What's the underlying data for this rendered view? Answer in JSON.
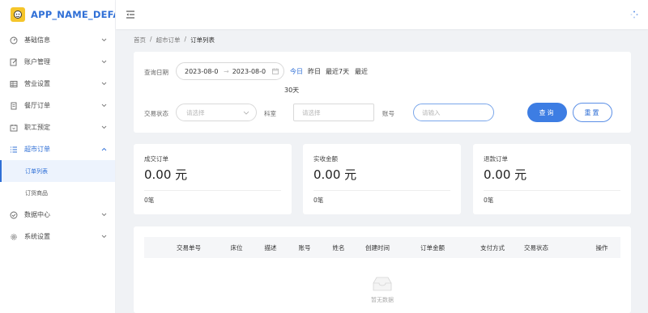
{
  "app": {
    "name": "APP_NAME_DEFAULT"
  },
  "sidebar": {
    "items": [
      {
        "label": "基础信息",
        "icon": "dashboard-icon"
      },
      {
        "label": "账户管理",
        "icon": "edit-icon"
      },
      {
        "label": "营业设置",
        "icon": "table-icon"
      },
      {
        "label": "餐厅订单",
        "icon": "document-icon"
      },
      {
        "label": "职工预定",
        "icon": "calendar-icon"
      },
      {
        "label": "超市订单",
        "icon": "list-icon",
        "open": true,
        "children": [
          {
            "label": "订单列表",
            "active": true
          },
          {
            "label": "订货商品"
          }
        ]
      },
      {
        "label": "数据中心",
        "icon": "check-circle-icon"
      },
      {
        "label": "系统设置",
        "icon": "gear-icon"
      }
    ]
  },
  "breadcrumb": {
    "items": [
      "首页",
      "超市订单",
      "订单列表"
    ]
  },
  "filter": {
    "date_label": "查询日期",
    "start_date": "2023-08-0",
    "end_date": "2023-08-0",
    "range_arrow": "→",
    "quick": {
      "today": "今日",
      "yesterday": "昨日",
      "last7": "最近7天",
      "last30_a": "最近",
      "last30_b": "30天"
    },
    "status_label": "交易状态",
    "status_placeholder": "请选择",
    "room_label": "科室",
    "room_placeholder": "请选择",
    "account_label": "账号",
    "account_placeholder": "请输入",
    "search_button": "查询",
    "reset_button": "重置"
  },
  "stats": [
    {
      "title": "成交订单",
      "value": "0.00 元",
      "count": "0笔"
    },
    {
      "title": "实收金额",
      "value": "0.00 元",
      "count": "0笔"
    },
    {
      "title": "退款订单",
      "value": "0.00 元",
      "count": "0笔"
    }
  ],
  "table": {
    "columns": [
      "交易单号",
      "床位",
      "描述",
      "账号",
      "姓名",
      "创建时间",
      "订单金额",
      "支付方式",
      "交易状态",
      "操作"
    ],
    "empty_text": "暂无数据"
  },
  "colors": {
    "accent": "#2f6fd6",
    "button_primary": "#3d7de3",
    "logo": "#f5c52a"
  }
}
